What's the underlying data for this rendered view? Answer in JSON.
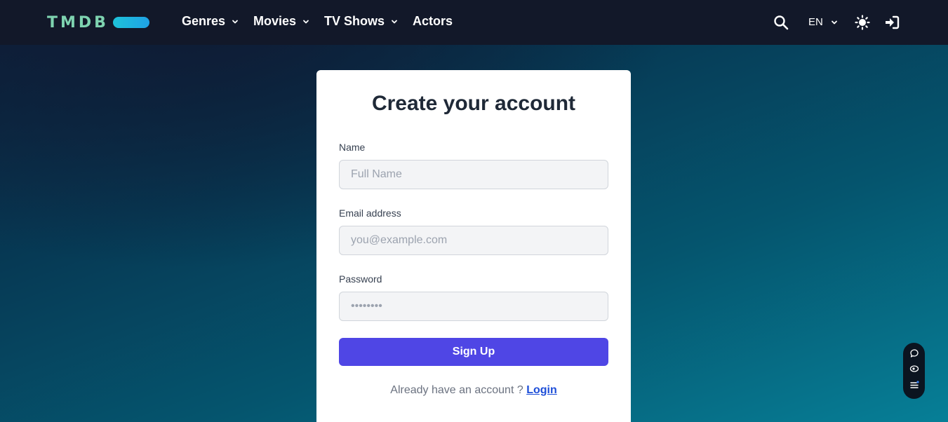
{
  "brand": {
    "logo_text": "TMDB"
  },
  "nav": {
    "items": [
      {
        "label": "Genres",
        "has_dropdown": true
      },
      {
        "label": "Movies",
        "has_dropdown": true
      },
      {
        "label": "TV Shows",
        "has_dropdown": true
      },
      {
        "label": "Actors",
        "has_dropdown": false
      }
    ],
    "language": "EN",
    "icons": [
      "search-icon",
      "chevron-down-icon",
      "sun-icon",
      "sign-in-icon"
    ]
  },
  "form": {
    "title": "Create your account",
    "name": {
      "label": "Name",
      "placeholder": "Full Name",
      "value": ""
    },
    "email": {
      "label": "Email address",
      "placeholder": "you@example.com",
      "value": ""
    },
    "password": {
      "label": "Password",
      "placeholder": "••••••••",
      "value": ""
    },
    "submit_label": "Sign Up",
    "footer_text": "Already have an account ?",
    "login_link": "Login"
  },
  "widget": {
    "icons": [
      "chat-icon",
      "eye-icon",
      "list-icon"
    ]
  },
  "colors": {
    "navbar_bg": "#121829",
    "logo_text": "#7ed3b0",
    "logo_pill": "#1ec2d9",
    "primary_button": "#4f46e5",
    "link": "#1d4ed8"
  }
}
